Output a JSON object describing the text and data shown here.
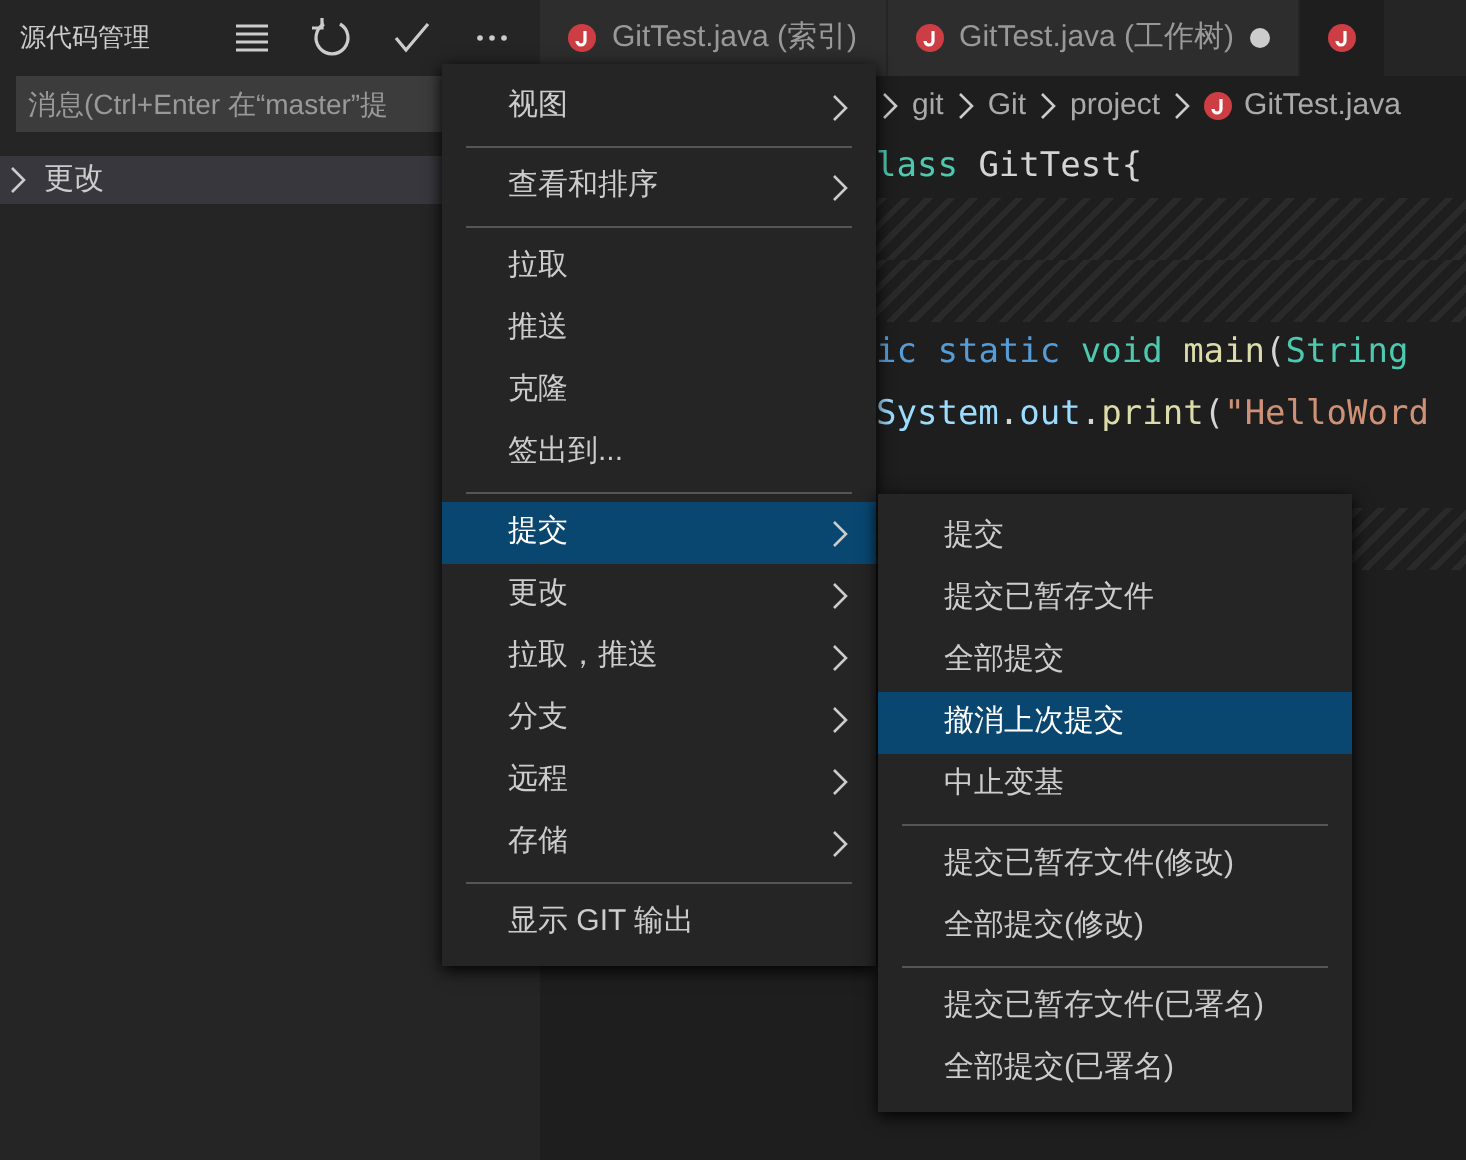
{
  "sidebar": {
    "title": "源代码管理",
    "toolbar": [
      {
        "kind": "menu"
      },
      {
        "kind": "refresh"
      },
      {
        "kind": "check"
      },
      {
        "kind": "more"
      }
    ],
    "message": {
      "placeholder": "消息(Ctrl+Enter 在“master”提"
    },
    "changes": {
      "label": "更改",
      "expanded": false
    }
  },
  "tabs": [
    {
      "label": "GitTest.java (索引)",
      "selected": false,
      "dirty": false
    },
    {
      "label": "GitTest.java (工作树)",
      "selected": false,
      "dirty": true
    },
    {
      "selected": true,
      "dirty": false
    }
  ],
  "breadcrumb": [
    "git",
    "Git",
    "project",
    "GitTest.java"
  ],
  "code": [
    {
      "kind": "code",
      "tokens": [
        {
          "t": "lass ",
          "kind": "type"
        },
        {
          "t": "GitTest{",
          "kind": "plain"
        }
      ]
    },
    {
      "kind": "hatch"
    },
    {
      "kind": "hatch"
    },
    {
      "kind": "code",
      "tokens": [
        {
          "t": "ic ",
          "kind": "keyword"
        },
        {
          "t": "static ",
          "kind": "keyword"
        },
        {
          "t": "void ",
          "kind": "type"
        },
        {
          "t": "main",
          "kind": "func"
        },
        {
          "t": "(",
          "kind": "plain"
        },
        {
          "t": "String",
          "kind": "type"
        }
      ]
    },
    {
      "kind": "code",
      "tokens": [
        {
          "t": "System",
          "kind": "var"
        },
        {
          "t": ".",
          "kind": "plain"
        },
        {
          "t": "out",
          "kind": "var"
        },
        {
          "t": ".",
          "kind": "plain"
        },
        {
          "t": "print",
          "kind": "func"
        },
        {
          "t": "(",
          "kind": "plain"
        },
        {
          "t": "\"HelloWord",
          "kind": "string"
        }
      ]
    },
    {
      "kind": "blank"
    },
    {
      "kind": "hatch"
    }
  ],
  "menu": {
    "items": [
      {
        "kind": "item",
        "label": "视图",
        "submenu": true,
        "selected": false
      },
      {
        "kind": "separator"
      },
      {
        "kind": "item",
        "label": "查看和排序",
        "submenu": true,
        "selected": false
      },
      {
        "kind": "separator"
      },
      {
        "kind": "item",
        "label": "拉取",
        "submenu": false,
        "selected": false
      },
      {
        "kind": "item",
        "label": "推送",
        "submenu": false,
        "selected": false
      },
      {
        "kind": "item",
        "label": "克隆",
        "submenu": false,
        "selected": false
      },
      {
        "kind": "item",
        "label": "签出到...",
        "submenu": false,
        "selected": false
      },
      {
        "kind": "separator"
      },
      {
        "kind": "item",
        "label": "提交",
        "submenu": true,
        "selected": true
      },
      {
        "kind": "item",
        "label": "更改",
        "submenu": true,
        "selected": false
      },
      {
        "kind": "item",
        "label": "拉取，推送",
        "submenu": true,
        "selected": false
      },
      {
        "kind": "item",
        "label": "分支",
        "submenu": true,
        "selected": false
      },
      {
        "kind": "item",
        "label": "远程",
        "submenu": true,
        "selected": false
      },
      {
        "kind": "item",
        "label": "存储",
        "submenu": true,
        "selected": false
      },
      {
        "kind": "separator"
      },
      {
        "kind": "item",
        "label": "显示 GIT 输出",
        "submenu": false,
        "selected": false
      }
    ]
  },
  "submenu": {
    "items": [
      {
        "kind": "item",
        "label": "提交",
        "selected": false
      },
      {
        "kind": "item",
        "label": "提交已暂存文件",
        "selected": false
      },
      {
        "kind": "item",
        "label": "全部提交",
        "selected": false
      },
      {
        "kind": "item",
        "label": "撤消上次提交",
        "selected": true
      },
      {
        "kind": "item",
        "label": "中止变基",
        "selected": false
      },
      {
        "kind": "separator"
      },
      {
        "kind": "item",
        "label": "提交已暂存文件(修改)",
        "selected": false
      },
      {
        "kind": "item",
        "label": "全部提交(修改)",
        "selected": false
      },
      {
        "kind": "separator"
      },
      {
        "kind": "item",
        "label": "提交已暂存文件(已署名)",
        "selected": false
      },
      {
        "kind": "item",
        "label": "全部提交(已署名)",
        "selected": false
      }
    ]
  }
}
